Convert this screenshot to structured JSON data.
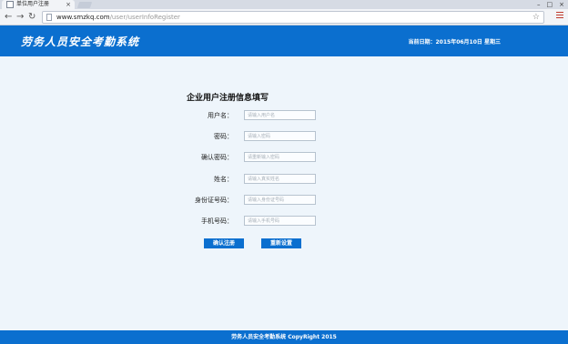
{
  "browser": {
    "tab_title": "单位用户注册",
    "tab_close": "×",
    "url_host": "www.smzkq.com",
    "url_path": "/user/userInfoRegister",
    "window_min": "–",
    "window_max": "□",
    "window_close": "×"
  },
  "header": {
    "site_title": "劳务人员安全考勤系统",
    "date_text": "当前日期：2015年06月10日 星期三"
  },
  "form": {
    "title": "企业用户注册信息填写",
    "fields": [
      {
        "label": "用户名：",
        "placeholder": "请输入用户名",
        "type": "text"
      },
      {
        "label": "密码：",
        "placeholder": "请输入密码",
        "type": "password"
      },
      {
        "label": "确认密码：",
        "placeholder": "请重新输入密码",
        "type": "password"
      },
      {
        "label": "姓名：",
        "placeholder": "请输入真实姓名",
        "type": "text"
      },
      {
        "label": "身份证号码：",
        "placeholder": "请输入身份证号码",
        "type": "text"
      },
      {
        "label": "手机号码：",
        "placeholder": "请输入手机号码",
        "type": "text"
      }
    ],
    "submit_label": "确认注册",
    "reset_label": "重新设置"
  },
  "footer": {
    "text": "劳务人员安全考勤系统 CopyRight 2015"
  },
  "colors": {
    "brand_blue": "#0b6fcf",
    "page_bg": "#eef5fb"
  }
}
